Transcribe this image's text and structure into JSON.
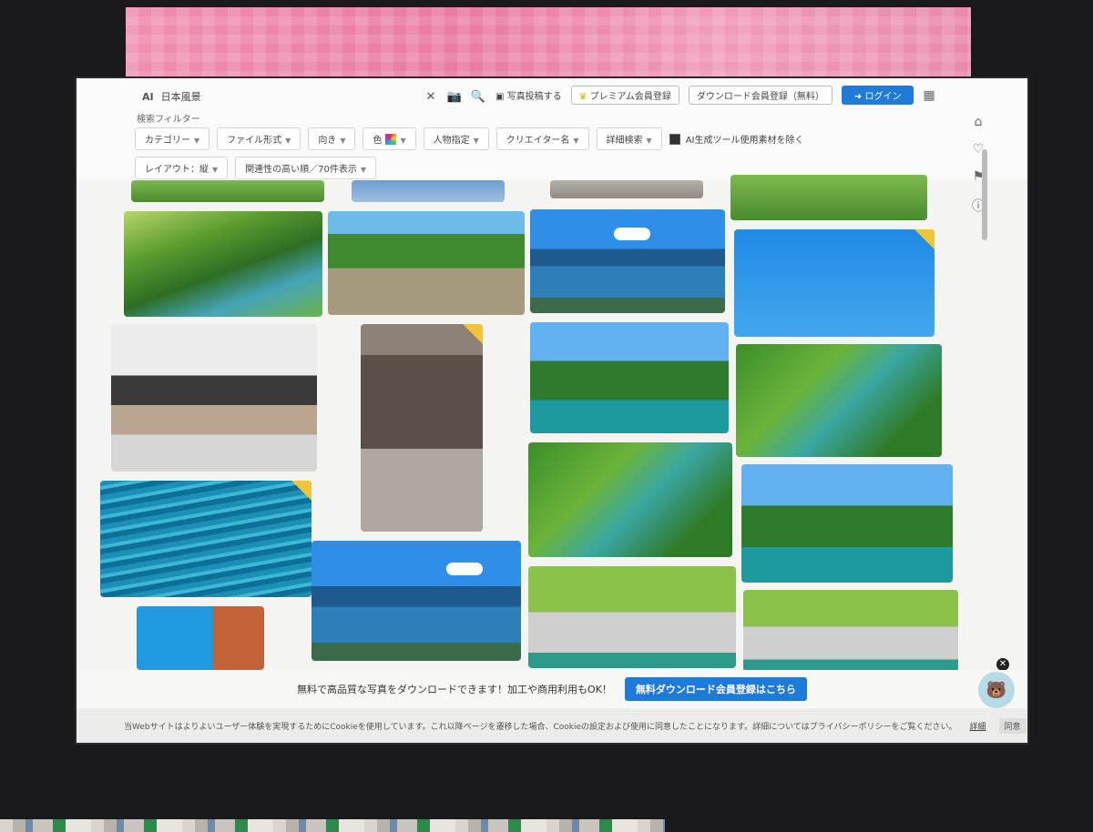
{
  "search": {
    "ai_mark": "AI",
    "value": "日本風景"
  },
  "header_actions": {
    "post_photo": "写真投稿する",
    "premium": "プレミアム会員登録",
    "free_register": "ダウンロード会員登録（無料）",
    "login": "ログイン"
  },
  "filters": {
    "heading": "検索フィルター",
    "category": "カテゴリー",
    "file_format": "ファイル形式",
    "orientation": "向き",
    "color": "色",
    "people": "人物指定",
    "creator": "クリエイター名",
    "advanced": "詳細検索",
    "ai_exclude": "AI生成ツール使用素材を除く",
    "layout": "レイアウト：縦",
    "sort": "関連性の高い順／70件表示"
  },
  "promo": {
    "text": "無料で高品質な写真をダウンロードできます！加工や商用利用もOK！",
    "button": "無料ダウンロード会員登録はこちら"
  },
  "cookie": {
    "text": "当Webサイトはよりよいユーザー体験を実現するためにCookieを使用しています。これ以降ページを遷移した場合、Cookieの設定および使用に同意したことになります。詳細についてはプライバシーポリシーをご覧ください。",
    "details": "詳細",
    "agree": "同意"
  },
  "icons": {
    "home": "home-icon",
    "favorite": "heart-icon",
    "bookmark": "bookmark-icon",
    "help": "help-icon"
  },
  "colors": {
    "accent": "#1f7ad8",
    "new_tag": "#f2c43a",
    "banner": "#ec8aad"
  }
}
